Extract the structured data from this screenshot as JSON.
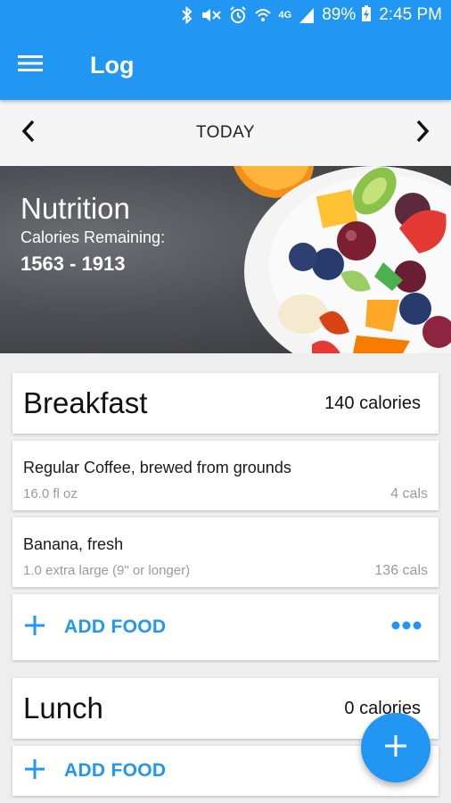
{
  "status_bar": {
    "battery_percent": "89%",
    "time": "2:45 PM",
    "icons": [
      "bluetooth-icon",
      "mute-icon",
      "alarm-icon",
      "wifi-icon",
      "lte-icon",
      "signal-icon",
      "battery-charging-icon"
    ],
    "network_label": "4G"
  },
  "app_bar": {
    "title": "Log",
    "menu_icon": "hamburger-menu-icon"
  },
  "date_nav": {
    "label": "TODAY",
    "prev_icon": "chevron-left-icon",
    "next_icon": "chevron-right-icon"
  },
  "nutrition": {
    "title": "Nutrition",
    "subtitle": "Calories Remaining:",
    "range": "1563 - 1913"
  },
  "meals": [
    {
      "name": "Breakfast",
      "calories": "140 calories",
      "foods": [
        {
          "name": "Regular Coffee, brewed from grounds",
          "portion": "16.0 fl oz",
          "cals": "4 cals"
        },
        {
          "name": "Banana, fresh",
          "portion": "1.0 extra large (9\" or longer)",
          "cals": "136 cals"
        }
      ],
      "add_label": "ADD FOOD"
    },
    {
      "name": "Lunch",
      "calories": "0 calories",
      "foods": [],
      "add_label": "ADD FOOD"
    }
  ],
  "colors": {
    "accent": "#2196F3",
    "background": "#eeeeee",
    "muted_text": "#9a9a9a"
  }
}
